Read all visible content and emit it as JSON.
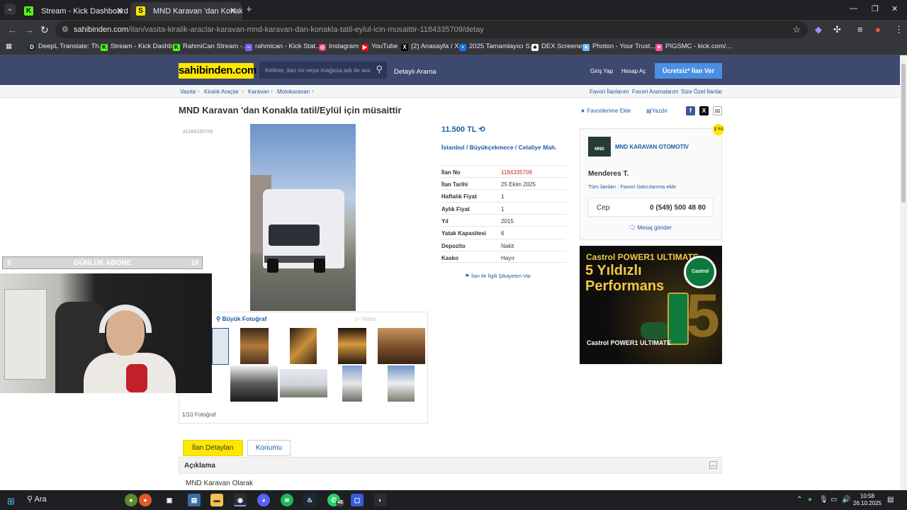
{
  "browser": {
    "tabs": [
      {
        "title": "Stream - Kick Dashboard",
        "favicon": "K",
        "favicon_color": "#53fc18",
        "active": false
      },
      {
        "title": "MND Karavan 'dan Konakla tat",
        "favicon": "S",
        "favicon_color": "#ffe800",
        "active": true
      }
    ],
    "url_host": "sahibinden.com",
    "url_path": "/ilan/vasita-kiralik-araclar-karavan-mnd-karavan-dan-konakla-tatil-eylul-icin-musaittir-1184335709/detay",
    "bookmarks": [
      {
        "label": "DeepL Translate: Th...",
        "icon_color": "#0f2b46",
        "glyph": "D"
      },
      {
        "label": "Stream - Kick Dashb...",
        "icon_color": "#53fc18",
        "glyph": "K"
      },
      {
        "label": "RahmiCan Stream -...",
        "icon_color": "#53fc18",
        "glyph": "K"
      },
      {
        "label": "rahmican - Kick Stat...",
        "icon_color": "#7b61ff",
        "glyph": "~"
      },
      {
        "label": "Instagram",
        "icon_color": "#e1306c",
        "glyph": "◎"
      },
      {
        "label": "YouTube",
        "icon_color": "#ff0000",
        "glyph": "▶"
      },
      {
        "label": "(2) Anasayfa / X",
        "icon_color": "#000000",
        "glyph": "X"
      },
      {
        "label": "2025 Tamamlayıcı S...",
        "icon_color": "#1a73e8",
        "glyph": "•"
      },
      {
        "label": "DEX Screener",
        "icon_color": "#ffffff",
        "glyph": "♣"
      },
      {
        "label": "Photon - Your Trust...",
        "icon_color": "#7ab8ff",
        "glyph": "♦"
      },
      {
        "label": "PIGSMC - kick.com/...",
        "icon_color": "#ff4fa3",
        "glyph": "♥"
      }
    ]
  },
  "site": {
    "logo": "sahibinden.com",
    "search_placeholder": "Kelime, ilan no veya mağaza adı ile ara",
    "advanced_search": "Detaylı Arama",
    "login": "Giriş Yap",
    "register": "Hesap Aç",
    "post_ad": "Ücretsiz* İlan Ver",
    "breadcrumb": [
      "Vasıta",
      "Kiralık Araçlar",
      "Karavan",
      "Motokaravan"
    ],
    "right_links": [
      "Favori İlanlarım",
      "Favori Aramalarım",
      "Size Özel İlanlar"
    ]
  },
  "listing": {
    "title": "MND Karavan 'dan Konakla tatil/Eylül için müsaittir",
    "add_favorite": "Favorilerime Ekle",
    "print": "Yazdır",
    "ad_id_label": "#1184335709",
    "price": "11.500 TL",
    "location": "İstanbul  /  Büyükçekmece  /  Celaliye Mah.",
    "details": [
      {
        "key": "İlan No",
        "value": "1184335709",
        "highlight": true
      },
      {
        "key": "İlan Tarihi",
        "value": "25 Ekim 2025"
      },
      {
        "key": "Haftalık Fiyat",
        "value": "1"
      },
      {
        "key": "Aylık Fiyat",
        "value": "1"
      },
      {
        "key": "Yıl",
        "value": "2015"
      },
      {
        "key": "Yatak Kapasitesi",
        "value": "6"
      },
      {
        "key": "Depozito",
        "value": "Nakit"
      },
      {
        "key": "Kasko",
        "value": "Hayır"
      }
    ],
    "complaint": "İlan ile İlgili Şikayetim Var",
    "big_photo": "Büyük Fotoğraf",
    "video": "Video",
    "photo_count": "1/10 Fotoğraf",
    "detail_tab": "İlan Detayları",
    "location_tab": "Konumu",
    "description_header": "Açıklama",
    "description_text": "MND Karavan Olarak"
  },
  "seller": {
    "store_name": "MND KARAVAN OTOMOTİV",
    "store_logo_text": "MND",
    "person": "Menderes T.",
    "all_ads": "Tüm ilanları",
    "add_fav_seller": "Favori Satıcılarıma ekle",
    "phone_label": "Cep",
    "phone": "0 (549) 500 48 80",
    "message": "Mesaj gönder",
    "badge": "2 Yıl"
  },
  "ad": {
    "line1": "Castrol POWER1 ULTIMATE",
    "line2": "5 Yıldızlı",
    "line3": "Performans",
    "circle": "Castrol",
    "big_digit": "5",
    "brand": "Castrol POWER1 ULTIMATE"
  },
  "stream": {
    "sub_left": "0",
    "sub_title": "GÜNLÜK ABONE",
    "sub_right": "10"
  },
  "taskbar": {
    "search": "Ara",
    "time": "10:58",
    "date": "26.10.2025",
    "whatsapp_badge": "45"
  }
}
